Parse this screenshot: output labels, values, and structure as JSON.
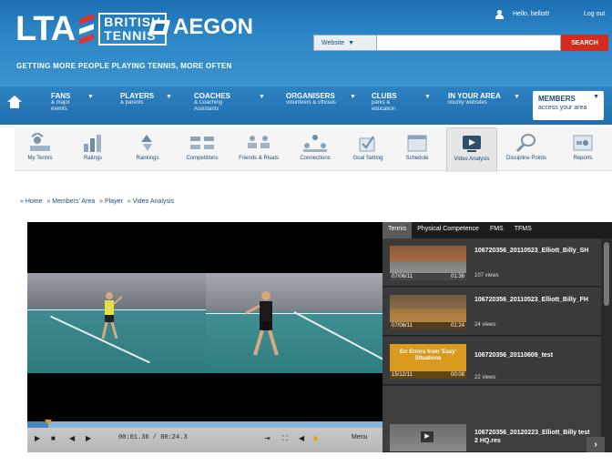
{
  "header": {
    "lta": "LTA",
    "british": "BRITISH",
    "tennis": "TENNIS",
    "aegon": "AEGON",
    "tagline": "GETTING MORE PEOPLE PLAYING TENNIS, MORE OFTEN",
    "hello": "Hello, bellott!",
    "logout": "Log out",
    "scope": "Website",
    "search_value": "",
    "search_label": "SEARCH"
  },
  "nav": {
    "items": [
      {
        "title": "FANS",
        "sub1": "& major",
        "sub2": "events"
      },
      {
        "title": "PLAYERS",
        "sub1": "& parents",
        "sub2": ""
      },
      {
        "title": "COACHES",
        "sub1": "& Coaching",
        "sub2": "Assistants"
      },
      {
        "title": "ORGANISERS",
        "sub1": "volunteers & officials",
        "sub2": ""
      },
      {
        "title": "CLUBS",
        "sub1": "parks &",
        "sub2": "education"
      },
      {
        "title": "IN YOUR AREA",
        "sub1": "county websites",
        "sub2": ""
      }
    ],
    "members": {
      "title": "MEMBERS",
      "sub": "access your area"
    }
  },
  "toolbar": {
    "items": [
      {
        "label": "My Tennis",
        "icon": "my-tennis-icon"
      },
      {
        "label": "Ratings",
        "icon": "ratings-icon"
      },
      {
        "label": "Rankings",
        "icon": "rankings-icon"
      },
      {
        "label": "Competitions",
        "icon": "competitions-icon"
      },
      {
        "label": "Friends & Rivals",
        "icon": "friends-rivals-icon"
      },
      {
        "label": "Connections",
        "icon": "connections-icon"
      },
      {
        "label": "Goal Setting",
        "icon": "goal-setting-icon"
      },
      {
        "label": "Schedule",
        "icon": "schedule-icon"
      },
      {
        "label": "Video Analysis",
        "icon": "video-analysis-icon"
      },
      {
        "label": "Discipline Points",
        "icon": "discipline-points-icon"
      },
      {
        "label": "Reports",
        "icon": "reports-icon"
      }
    ],
    "active": "Video Analysis"
  },
  "breadcrumb": [
    "» Home",
    "» Members' Area",
    "» Player",
    "» Video Analysis"
  ],
  "player": {
    "timecode": "00:01.36 / 00:24.3",
    "progress": 0.06,
    "menu": "Menu"
  },
  "playlist": {
    "tabs": [
      "Tennis",
      "Physical Competence",
      "FMS",
      "TFMS"
    ],
    "active_tab": "Tennis",
    "items": [
      {
        "title": "106720356_20110523_Elliott_Billy_SH",
        "views": "107 views",
        "date": "07/06/11",
        "duration": "01:36"
      },
      {
        "title": "106720356_20110523_Elliott_Billy_FH",
        "views": "24 views",
        "date": "07/06/11",
        "duration": "01:24"
      },
      {
        "title": "106720356_20110609_test",
        "views": "22 views",
        "date": "15/12/11",
        "duration": "00:08",
        "thumb_text": "Err Errors from 'Easy' Situations"
      },
      {
        "title": "106720356_20120223_Elliott_Billy test 2 HQ.res",
        "views": "",
        "date": "",
        "duration": ""
      }
    ]
  },
  "colors": {
    "header_blue": "#1c6fb2",
    "search_red": "#d52b1e",
    "link_blue": "#1c4a7a"
  }
}
